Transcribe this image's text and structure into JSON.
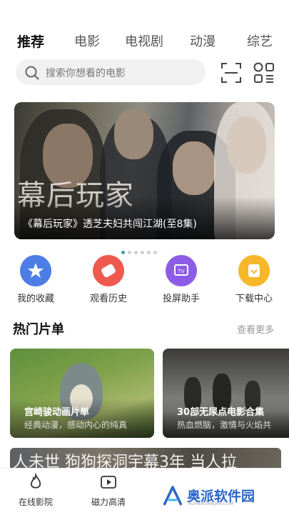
{
  "tabs": [
    {
      "label": "推荐",
      "active": true
    },
    {
      "label": "电影"
    },
    {
      "label": "电视剧"
    },
    {
      "label": "动漫"
    },
    {
      "label": "综艺"
    }
  ],
  "search": {
    "placeholder": "搜索你想看的电影"
  },
  "banner": {
    "title_text": "幕后玩家",
    "caption": "《幕后玩家》透芝夫妇共闯江湖(至8集)",
    "page_count": 6,
    "active_page": 1
  },
  "quick_actions": [
    {
      "label": "我的收藏",
      "icon": "star-icon",
      "color": "#4d7de6"
    },
    {
      "label": "观看历史",
      "icon": "history-icon",
      "color": "#ee5a4f"
    },
    {
      "label": "投屏助手",
      "icon": "tv-cast-icon",
      "color": "#8c5ce6"
    },
    {
      "label": "下载中心",
      "icon": "download-icon",
      "color": "#f7b72a"
    }
  ],
  "section": {
    "title": "热门片单",
    "more": "查看更多"
  },
  "playlists": [
    {
      "title": "宫崎骏动画片单",
      "subtitle": "经典动漫，感动内心的纯真"
    },
    {
      "title": "30部无尿点电影合集",
      "subtitle": "热血燃脑，激情与火焰共"
    }
  ],
  "partial_strip_text": "人未世 狗狗探洞宇幕3年 当人拉",
  "bottom_nav": [
    {
      "label": "在线影院",
      "icon": "flame-icon",
      "active": true
    },
    {
      "label": "磁力高清",
      "icon": "play-icon"
    }
  ],
  "watermark": {
    "text": "奥派软件园",
    "sub": "AUPAIRUANJIAN.COM"
  }
}
